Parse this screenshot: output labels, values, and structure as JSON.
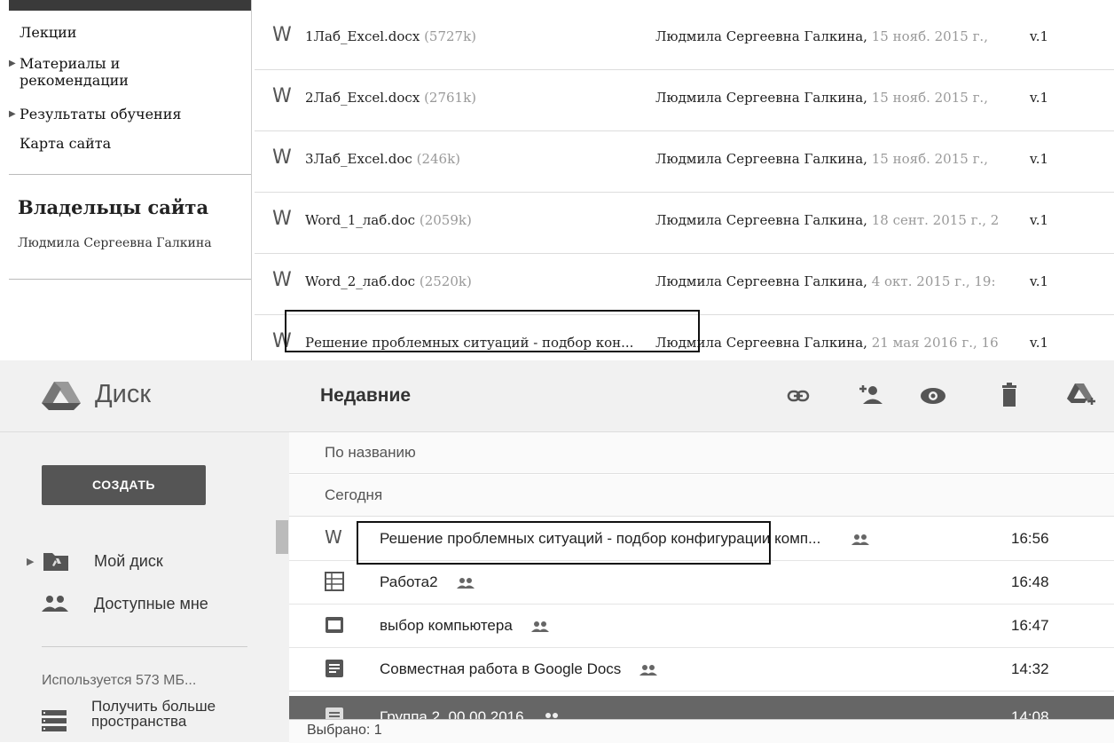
{
  "sites": {
    "nav": [
      {
        "label": "Лекции",
        "expandable": false
      },
      {
        "label": "Материалы и рекомендации",
        "line1": "Материалы и",
        "line2": "рекомендации",
        "expandable": true
      },
      {
        "label": "Результаты обучения",
        "expandable": true
      },
      {
        "label": "Карта сайта",
        "expandable": false
      }
    ],
    "owners_title": "Владельцы сайта",
    "owner_name": "Людмила Сергеевна Галкина",
    "files": [
      {
        "name": "1Лаб_Excel.docx",
        "size": "(5727k)",
        "author": "Людмила Сергеевна Галкина,",
        "date": "15 нояб. 2015 г.,",
        "version": "v.1"
      },
      {
        "name": "2Лаб_Excel.docx",
        "size": "(2761k)",
        "author": "Людмила Сергеевна Галкина,",
        "date": "15 нояб. 2015 г.,",
        "version": "v.1"
      },
      {
        "name": "3Лаб_Excel.doc",
        "size": "(246k)",
        "author": "Людмила Сергеевна Галкина,",
        "date": "15 нояб. 2015 г.,",
        "version": "v.1"
      },
      {
        "name": "Word_1_лаб.doc",
        "size": "(2059k)",
        "author": "Людмила Сергеевна Галкина,",
        "date": "18 сент. 2015 г., 2",
        "version": "v.1"
      },
      {
        "name": "Word_2_лаб.doc",
        "size": "(2520k)",
        "author": "Людмила Сергеевна Галкина,",
        "date": "4 окт. 2015 г., 19:",
        "version": "v.1"
      },
      {
        "name": "Решение проблемных ситуаций - подбор кон...",
        "size": "",
        "author": "Людмила Сергеевна Галкина,",
        "date": "21 мая 2016 г., 16",
        "version": "v.1"
      }
    ]
  },
  "drive": {
    "title": "Диск",
    "view_title": "Недавние",
    "toolbar_icons": [
      "link-icon",
      "add-person-icon",
      "eye-icon",
      "trash-icon",
      "drive-add-icon"
    ],
    "create_label": "СОЗДАТЬ",
    "sidebar": {
      "my_drive": "Мой диск",
      "shared": "Доступные мне",
      "storage": "Используется 573 МБ...",
      "get_more_line1": "Получить больше",
      "get_more_line2": "пространства"
    },
    "sort_label": "По названию",
    "group_label": "Сегодня",
    "rows": [
      {
        "name": "Решение проблемных ситуаций - подбор конфигурации комп...",
        "icon": "word-icon",
        "shared": true,
        "time": "16:56"
      },
      {
        "name": "Работа2",
        "icon": "spreadsheet-icon",
        "shared": true,
        "time": "16:48"
      },
      {
        "name": "выбор компьютера",
        "icon": "presentation-icon",
        "shared": true,
        "time": "16:47"
      },
      {
        "name": "Совместная работа в Google Docs",
        "icon": "document-icon",
        "shared": true,
        "time": "14:32"
      },
      {
        "name": "Группа 2, 00.00.2016",
        "icon": "document-icon",
        "shared": true,
        "time": "14:08"
      }
    ],
    "selected_text": "Выбрано: 1"
  }
}
